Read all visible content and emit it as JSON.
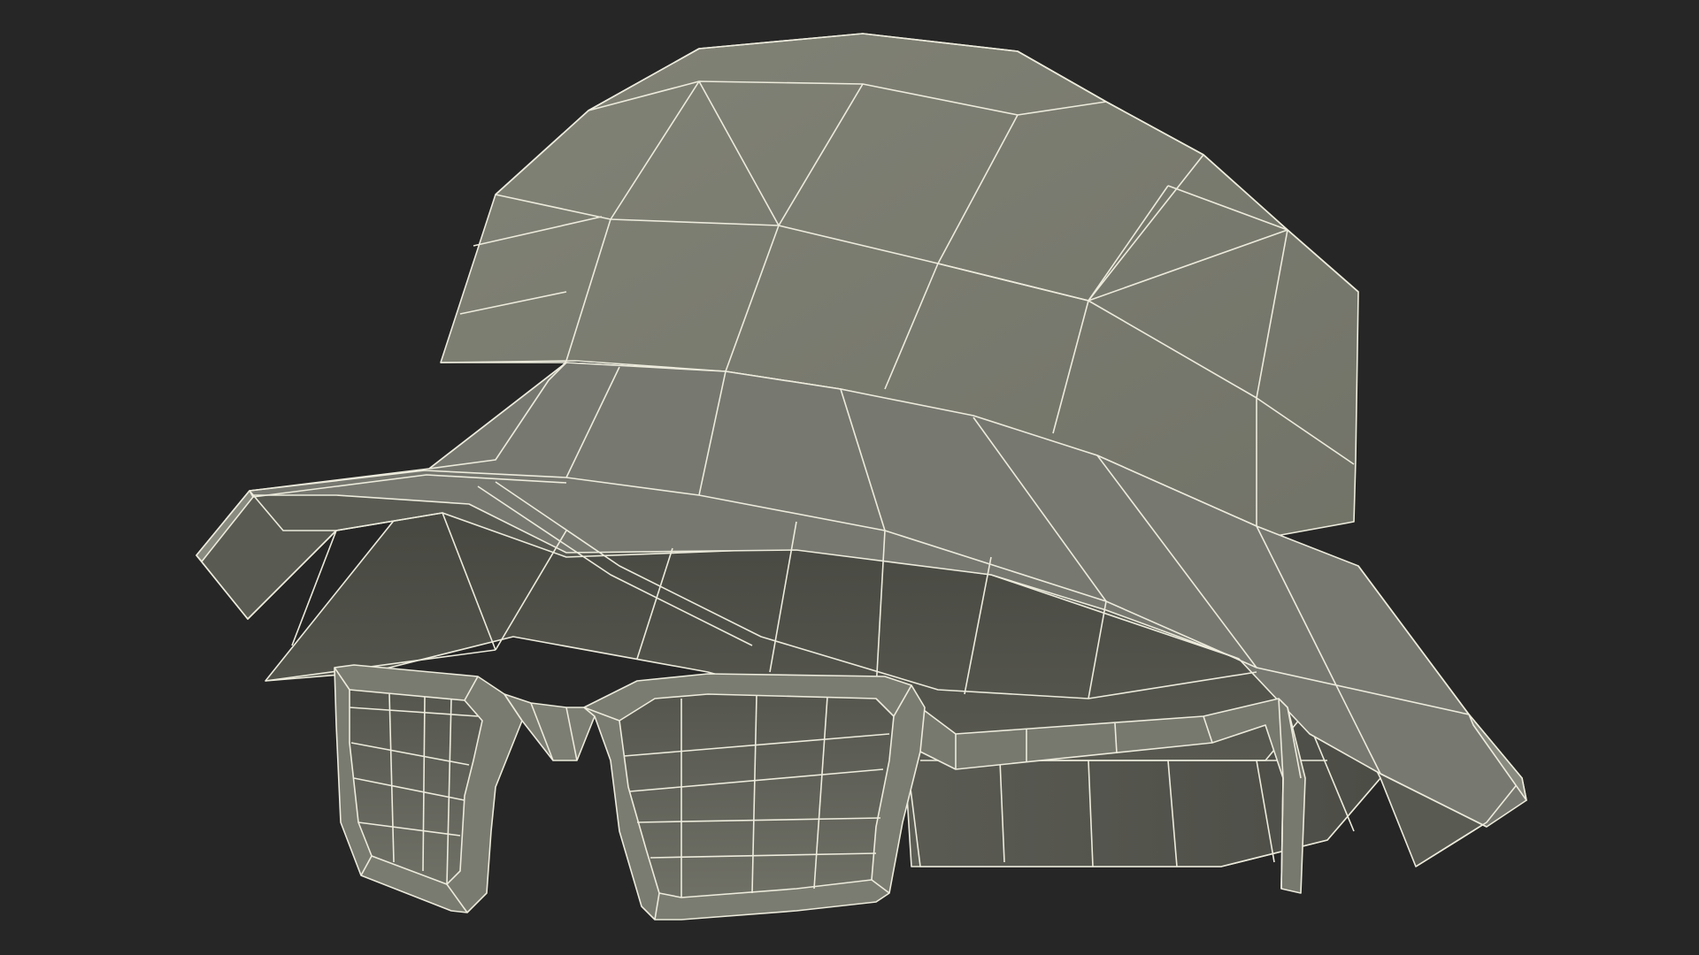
{
  "scene": {
    "subject": "bucket-hat-and-sunglasses-wireframe",
    "colors": {
      "background": "#262626",
      "surface_light": "#7a7b6f",
      "surface_mid": "#6c6d62",
      "surface_dark": "#4f5049",
      "surface_shadow": "#2f302b",
      "wire": "#ecebdc"
    }
  }
}
